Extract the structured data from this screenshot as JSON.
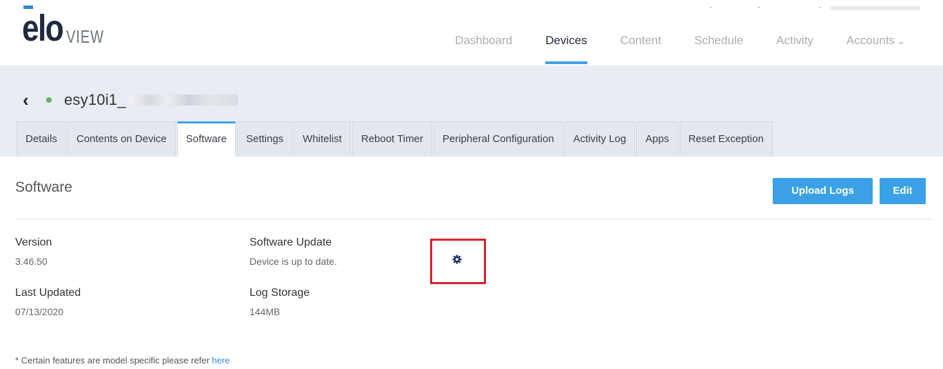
{
  "brand": {
    "logo_main": "elo",
    "logo_sub": "VIEW",
    "accent_color": "#3fa2e6"
  },
  "nav": {
    "items": [
      {
        "label": "Dashboard",
        "active": false
      },
      {
        "label": "Devices",
        "active": true
      },
      {
        "label": "Content",
        "active": false
      },
      {
        "label": "Schedule",
        "active": false
      },
      {
        "label": "Activity",
        "active": false
      },
      {
        "label": "Accounts",
        "active": false,
        "icon": "chevron-down-icon"
      }
    ]
  },
  "device": {
    "name": "esy10i1_",
    "status_color": "#5cb85c",
    "back_icon": "chevron-left-icon"
  },
  "tabs": [
    {
      "label": "Details"
    },
    {
      "label": "Contents on Device"
    },
    {
      "label": "Software",
      "active": true
    },
    {
      "label": "Settings"
    },
    {
      "label": "Whitelist"
    },
    {
      "label": "Reboot Timer"
    },
    {
      "label": "Peripheral Configuration"
    },
    {
      "label": "Activity Log"
    },
    {
      "label": "Apps"
    },
    {
      "label": "Reset Exception"
    }
  ],
  "section": {
    "title": "Software",
    "upload_logs_label": "Upload Logs",
    "edit_label": "Edit",
    "button_color": "#3aa1e6"
  },
  "fields": {
    "version": {
      "label": "Version",
      "value": "3.46.50"
    },
    "last_updated": {
      "label": "Last Updated",
      "value": "07/13/2020"
    },
    "software_update": {
      "label": "Software Update",
      "value": "Device is up to date.",
      "icon": "gear-icon"
    },
    "log_storage": {
      "label": "Log Storage",
      "value": "144MB"
    }
  },
  "footnote": {
    "text": "* Certain features are model specific please refer ",
    "link": "here"
  }
}
